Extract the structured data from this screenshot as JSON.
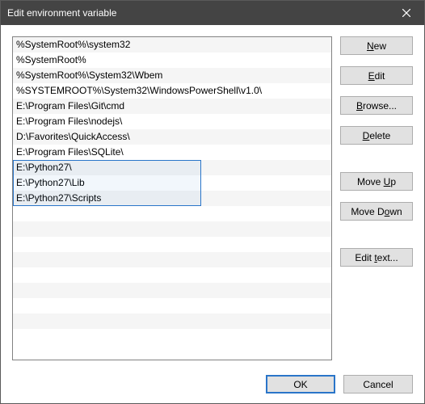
{
  "dialog": {
    "title": "Edit environment variable"
  },
  "entries": [
    "%SystemRoot%\\system32",
    "%SystemRoot%",
    "%SystemRoot%\\System32\\Wbem",
    "%SYSTEMROOT%\\System32\\WindowsPowerShell\\v1.0\\",
    "E:\\Program Files\\Git\\cmd",
    "E:\\Program Files\\nodejs\\",
    "D:\\Favorites\\QuickAccess\\",
    "E:\\Program Files\\SQLite\\",
    "E:\\Python27\\",
    "E:\\Python27\\Lib",
    "E:\\Python27\\Scripts"
  ],
  "selection": {
    "start": 8,
    "end": 10
  },
  "buttons": {
    "new": "New",
    "edit": "Edit",
    "browse": "Browse...",
    "delete": "Delete",
    "moveup": "Move Up",
    "movedown": "Move Down",
    "edittext": "Edit text...",
    "ok": "OK",
    "cancel": "Cancel"
  }
}
